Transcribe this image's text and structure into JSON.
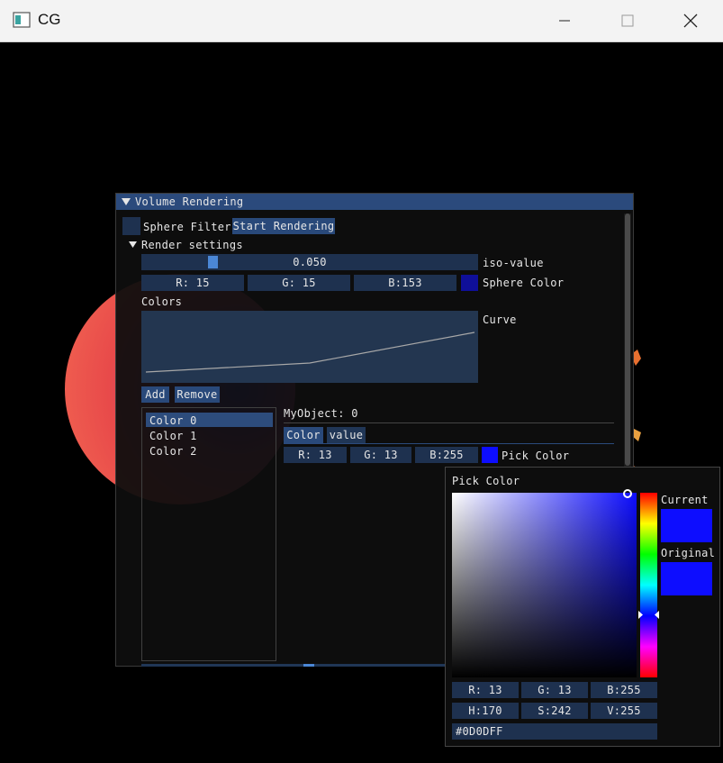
{
  "window": {
    "title": "CG"
  },
  "volume_window": {
    "title": "Volume Rendering",
    "sphere_filter_label": "Sphere Filter",
    "start_rendering_label": "Start Rendering",
    "render_settings_label": "Render settings",
    "iso_slider": {
      "value": "0.050",
      "label": "iso-value",
      "fraction": 0.05
    },
    "sphere_color": {
      "r": "R: 15",
      "g": "G: 15",
      "b": "B:153",
      "label": "Sphere Color",
      "hex": "#0f0f99"
    },
    "colors_label": "Colors",
    "curve_label": "Curve",
    "add_label": "Add",
    "remove_label": "Remove",
    "color_list": [
      "Color 0",
      "Color 1",
      "Color 2"
    ],
    "my_object_label": "MyObject: 0",
    "tabs": [
      "Color",
      "value"
    ],
    "pick": {
      "r": "R: 13",
      "g": "G: 13",
      "b": "B:255",
      "label": "Pick Color",
      "hex": "#0d0dff"
    }
  },
  "picker": {
    "title": "Pick Color",
    "current_label": "Current",
    "original_label": "Original",
    "rgb": [
      "R: 13",
      "G: 13",
      "B:255"
    ],
    "hsv": [
      "H:170",
      "S:242",
      "V:255"
    ],
    "hex_value": "#0D0DFF",
    "current_color": "#0d0dff",
    "original_color": "#0d0dff"
  }
}
